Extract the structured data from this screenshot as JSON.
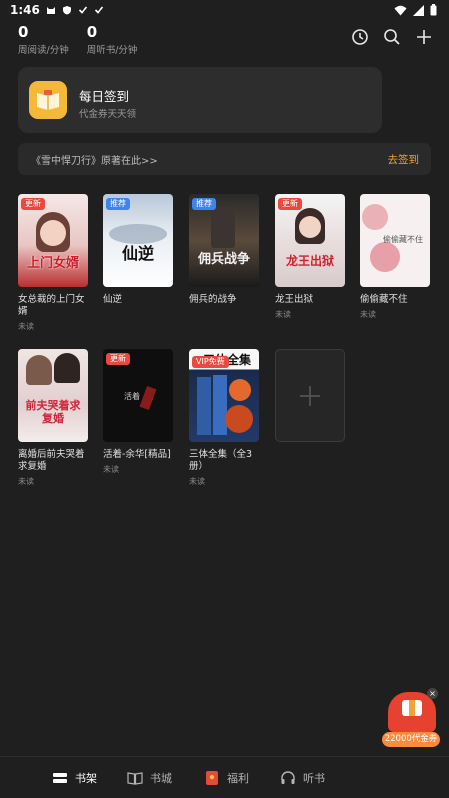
{
  "status_bar": {
    "time": "1:46"
  },
  "stats": [
    {
      "value": "0",
      "label": "周阅读/分钟"
    },
    {
      "value": "0",
      "label": "周听书/分钟"
    }
  ],
  "top_actions": [
    "history-icon",
    "search-icon",
    "plus-icon"
  ],
  "sign_in": {
    "title": "每日签到",
    "subtitle": "代金券天天领"
  },
  "notice": {
    "text": "《雪中悍刀行》原著在此>>",
    "link": "去签到"
  },
  "books": [
    {
      "name": "女总裁的上门女婿",
      "state": "未读",
      "tag": "更新",
      "tag_color": "red",
      "cover_title": "上门女婿"
    },
    {
      "name": "仙逆",
      "state": "",
      "tag": "推荐",
      "tag_color": "blue",
      "cover_title": "仙逆"
    },
    {
      "name": "佣兵的战争",
      "state": "",
      "tag": "推荐",
      "tag_color": "blue",
      "cover_title": "佣兵战争"
    },
    {
      "name": "龙王出狱",
      "state": "未读",
      "tag": "更新",
      "tag_color": "red",
      "cover_title": "龙王出狱"
    },
    {
      "name": "偷偷藏不住",
      "state": "未读",
      "tag": "",
      "tag_color": "",
      "cover_title": "偷偷藏不住"
    },
    {
      "name": "离婚后前夫哭着求复婚",
      "state": "未读",
      "tag": "",
      "tag_color": "",
      "cover_title": "前夫哭着求复婚"
    },
    {
      "name": "活着-余华[精品]",
      "state": "未读",
      "tag": "更新",
      "tag_color": "red",
      "cover_title": "活着"
    },
    {
      "name": "三体全集（全3册）",
      "state": "未读",
      "tag": "VIP免费",
      "tag_color": "red",
      "cover_title": "三体全集"
    }
  ],
  "coupon": {
    "label": "22000代金券"
  },
  "bottom_nav": [
    {
      "label": "书架",
      "active": true
    },
    {
      "label": "书城",
      "active": false
    },
    {
      "label": "福利",
      "active": false
    },
    {
      "label": "听书",
      "active": false
    }
  ],
  "colors": {
    "background": "#1f1f1f",
    "card": "#2d2d2d",
    "accent": "#f0a430"
  }
}
